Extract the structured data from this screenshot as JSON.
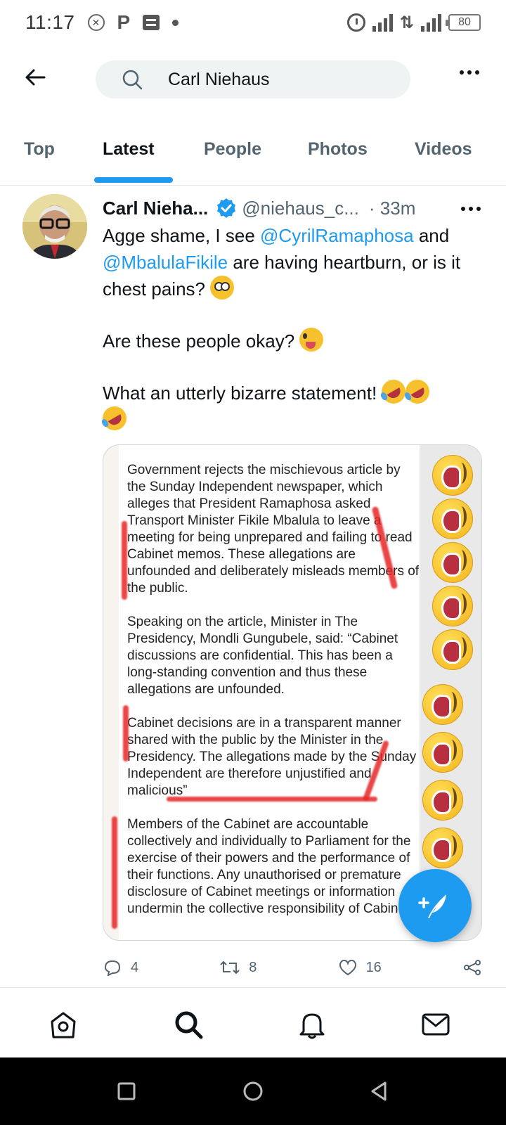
{
  "status_bar": {
    "time": "11:17",
    "battery": "80",
    "icons": [
      "notification-x-icon",
      "p-icon",
      "message-icon",
      "dot-icon",
      "alarm-icon",
      "signal-icon",
      "data-arrows-icon",
      "hplus-signal-icon",
      "battery-icon"
    ]
  },
  "header": {
    "search_value": "Carl Niehaus"
  },
  "tabs": [
    {
      "label": "Top"
    },
    {
      "label": "Latest"
    },
    {
      "label": "People"
    },
    {
      "label": "Photos"
    },
    {
      "label": "Videos"
    }
  ],
  "active_tab": "Latest",
  "tweet": {
    "name": "Carl Nieha...",
    "handle": "@niehaus_c...",
    "time": "· 33m",
    "line1_pre": "Agge shame, I see ",
    "mention1": "@CyrilRamaphosa",
    "line1_mid": " and ",
    "mention2": "@MbalulaFikile",
    "line1_post": " are having heartburn, or is it chest pains? ",
    "line2": "Are these people okay? ",
    "line3": "What an utterly bizarre statement! ",
    "media_paragraphs": [
      "Government rejects the mischievous article by the Sunday Independent newspaper, which alleges that President Ramaphosa asked Transport Minister Fikile Mbalula to leave a meeting for being unprepared and failing to read Cabinet memos. These allegations are unfounded and deliberately misleads members of the public.",
      "Speaking on the article, Minister in The Presidency, Mondli Gungubele, said: “Cabinet discussions  are confidential. This has been a long-standing convention and thus these allegations are unfounded.",
      "Cabinet decisions are in a transparent manner shared with the public by the Minister in the Presidency. The allegations made by the Sunday Independent are therefore unjustified and malicious”",
      "Members of the Cabinet are accountable collectively and individually to Parliament for the exercise of their powers and the performance of their functions. Any unauthorised or premature disclosure of Cabinet meetings or information undermin the collective responsibility of Cabinet."
    ],
    "actions": {
      "reply_count": "4",
      "retweet_count": "8",
      "like_count": "16"
    }
  },
  "colors": {
    "accent": "#1d9bf0",
    "text": "#0f1419",
    "secondary": "#536471"
  },
  "bottom_nav": [
    "home-icon",
    "search-icon",
    "notifications-icon",
    "messages-icon"
  ],
  "android_nav": [
    "recents-icon",
    "home-circle-icon",
    "back-triangle-icon"
  ]
}
